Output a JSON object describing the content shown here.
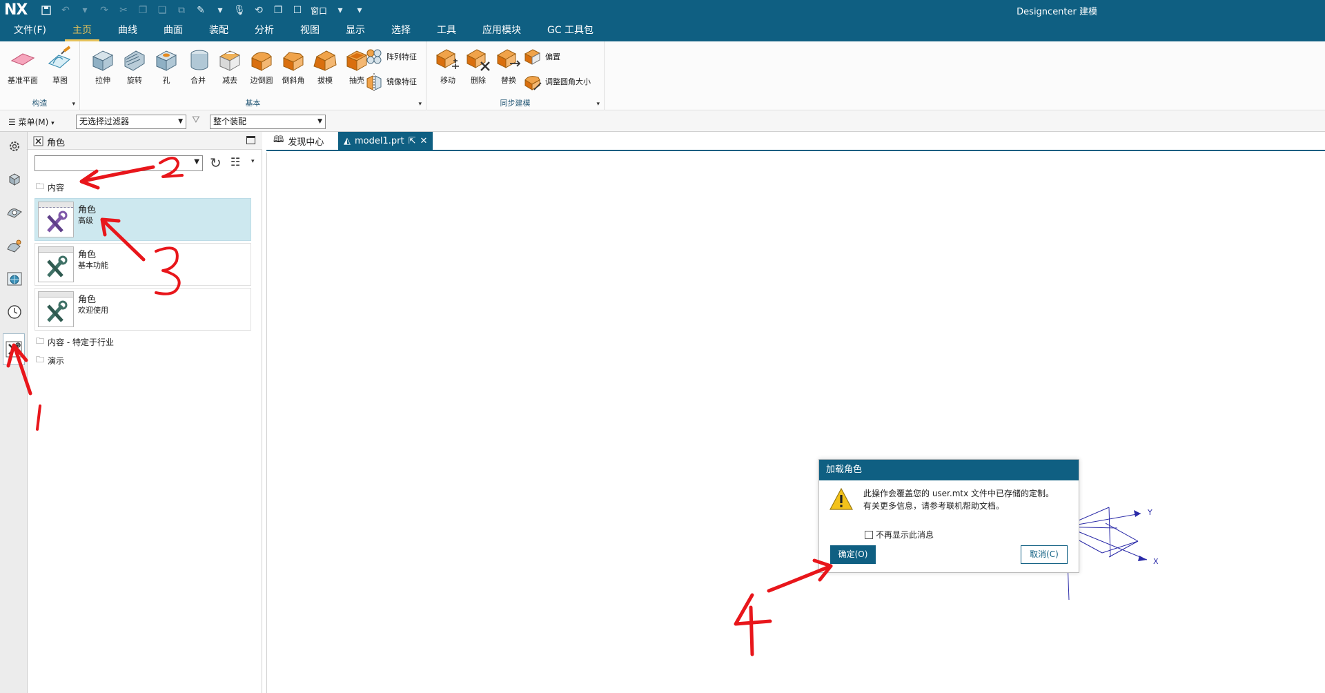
{
  "app": {
    "logo": "NX",
    "title": "Designcenter 建模",
    "qat_window_label": "窗口"
  },
  "menu_tabs": [
    {
      "label": "文件(F)"
    },
    {
      "label": "主页"
    },
    {
      "label": "曲线"
    },
    {
      "label": "曲面"
    },
    {
      "label": "装配"
    },
    {
      "label": "分析"
    },
    {
      "label": "视图"
    },
    {
      "label": "显示"
    },
    {
      "label": "选择"
    },
    {
      "label": "工具"
    },
    {
      "label": "应用模块"
    },
    {
      "label": "GC 工具包"
    }
  ],
  "ribbon": {
    "groups": {
      "construct": "构造",
      "basic": "基本",
      "sync": "同步建模"
    },
    "construct_buttons": [
      "基准平面",
      "草图"
    ],
    "basic_buttons": [
      "拉伸",
      "旋转",
      "孔",
      "合并",
      "减去",
      "边倒圆",
      "倒斜角",
      "拔模",
      "抽壳"
    ],
    "basic_small": [
      "阵列特征",
      "镜像特征"
    ],
    "sync_buttons": [
      "移动",
      "删除",
      "替换"
    ],
    "sync_small": [
      "偏置",
      "调整圆角大小"
    ]
  },
  "selection_bar": {
    "menu_label": "菜单(M)",
    "filter_value": "无选择过滤器",
    "scope_value": "整个装配"
  },
  "panel": {
    "title": "角色",
    "folder_content": "内容",
    "roles": [
      {
        "name": "角色",
        "desc": "高级"
      },
      {
        "name": "角色",
        "desc": "基本功能"
      },
      {
        "name": "角色",
        "desc": "欢迎使用"
      }
    ],
    "folder_industry": "内容 - 特定于行业",
    "folder_demo": "演示"
  },
  "graphics_tabs": {
    "discovery": "发现中心",
    "model": "model1.prt"
  },
  "dialog": {
    "title": "加载角色",
    "message_line1": "此操作会覆盖您的 user.mtx 文件中已存储的定制。",
    "message_line2": "有关更多信息，请参考联机帮助文档。",
    "checkbox_label": "不再显示此消息",
    "ok_label": "确定(O)",
    "cancel_label": "取消(C)"
  },
  "axes": {
    "y_label": "Y",
    "x_label": "X"
  },
  "annotations": [
    "1",
    "2",
    "3",
    "4"
  ],
  "colors": {
    "titlebar": "#0f5f82",
    "active_tab": "#e7c35a",
    "selected_row": "#cde8ef",
    "annotation": "#e8161b"
  }
}
